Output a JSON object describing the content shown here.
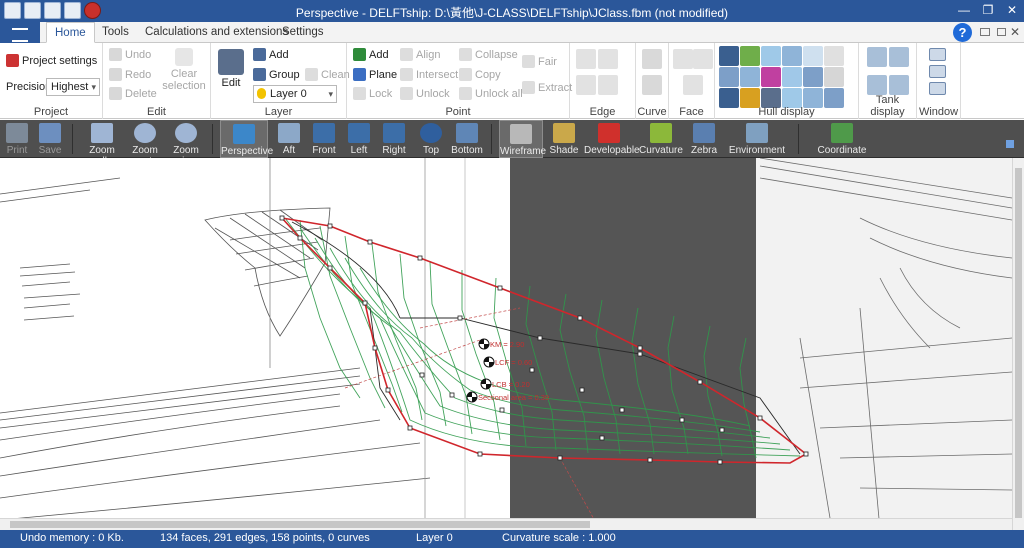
{
  "window": {
    "title": "Perspective - DELFTship: D:\\黃他\\J-CLASS\\DELFTship\\JClass.fbm (not modified)",
    "minimize": "—",
    "restore": "❐",
    "close": "✕"
  },
  "tabs": [
    "Home",
    "Tools",
    "Calculations and extensions",
    "Settings"
  ],
  "help_label": "?",
  "ribbon": {
    "project": {
      "label": "Project",
      "settings": "Project settings",
      "precision_label": "Precision",
      "precision_value": "Highest"
    },
    "edit": {
      "label": "Edit",
      "undo": "Undo",
      "redo": "Redo",
      "delete": "Delete",
      "clear_selection": "Clear selection"
    },
    "layer": {
      "label": "Layer",
      "edit": "Edit",
      "add": "Add",
      "group": "Group",
      "clean": "Clean",
      "current": "Layer 0"
    },
    "point": {
      "label": "Point",
      "add": "Add",
      "plane": "Plane",
      "lock": "Lock",
      "align": "Align",
      "intersect": "Intersect",
      "unlock": "Unlock",
      "collapse": "Collapse",
      "copy": "Copy",
      "unlock_all": "Unlock all",
      "fair": "Fair",
      "extract": "Extract"
    },
    "edge_label": "Edge",
    "curve_label": "Curve",
    "face_label": "Face",
    "hull_display_label": "Hull display",
    "tank_display_label": "Tank display",
    "window_label": "Window"
  },
  "toolbar": [
    "Print",
    "Save",
    "Zoom all",
    "Zoom out",
    "Zoom in",
    "Perspective",
    "Aft",
    "Front",
    "Left",
    "Right",
    "Top",
    "Bottom",
    "Wireframe",
    "Shade",
    "Developable",
    "Curvature",
    "Zebra",
    "Environment map",
    "Coordinate axes"
  ],
  "markers": [
    "KM = 2.90",
    "LCF = 0.60",
    "LCB = 0.20",
    "Sectional area = 0.39"
  ],
  "status": {
    "undo": "Undo memory : 0 Kb.",
    "geometry": "134 faces, 291 edges, 158 points, 0 curves",
    "layer": "Layer 0",
    "curvature": "Curvature scale : 1.000"
  },
  "colors": {
    "title_bar": "#2b579a",
    "toolbar": "#4f4f4f",
    "hull_wire": "#2e9a4a",
    "hull_outline": "#d0262c",
    "backdrop_panel": "#555555"
  },
  "icons": {
    "print": "printer-icon",
    "save": "floppy-icon",
    "zoom_all": "zoom-all-icon",
    "zoom_out": "zoom-out-icon",
    "zoom_in": "zoom-in-icon",
    "wireframe": "wireframe-icon",
    "shade": "shade-icon",
    "developable": "developable-icon",
    "curvature": "curvature-icon",
    "zebra": "zebra-icon",
    "environment_map": "environment-map-icon",
    "coordinate_axes": "coordinate-axes-icon"
  }
}
